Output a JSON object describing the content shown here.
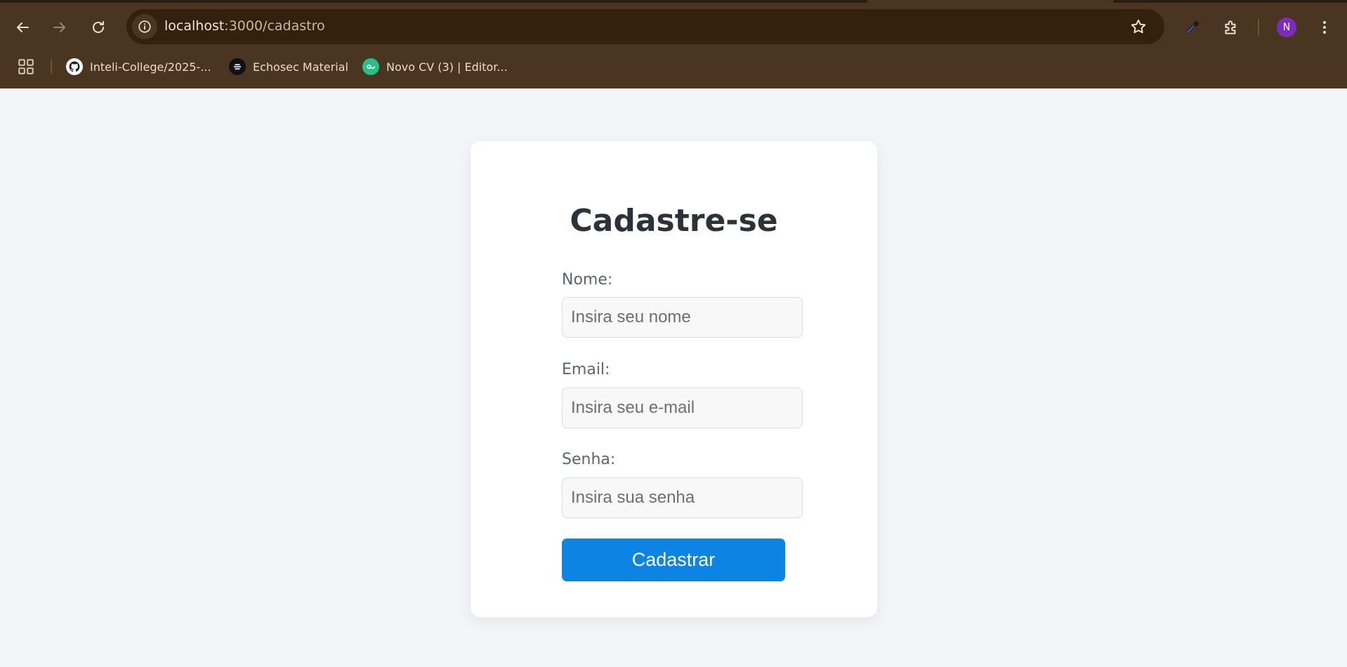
{
  "browser": {
    "url_host": "localhost",
    "url_path": ":3000/cadastro",
    "avatar_initial": "N",
    "bookmarks": [
      {
        "label": "Inteli-College/2025-...",
        "icon": "github-icon"
      },
      {
        "label": "Echosec Material",
        "icon": "echosec-icon"
      },
      {
        "label": "Novo CV (3) | Editor...",
        "icon": "novo-cv-icon"
      }
    ]
  },
  "form": {
    "title": "Cadastre-se",
    "name_label": "Nome:",
    "name_placeholder": "Insira seu nome",
    "email_label": "Email:",
    "email_placeholder": "Insira seu e-mail",
    "password_label": "Senha:",
    "password_placeholder": "Insira sua senha",
    "submit_label": "Cadastrar"
  },
  "colors": {
    "chrome_bg": "#4a3520",
    "page_bg": "#f4f5f9",
    "button_bg": "#0b84e3",
    "avatar_bg": "#7b2cbf"
  }
}
